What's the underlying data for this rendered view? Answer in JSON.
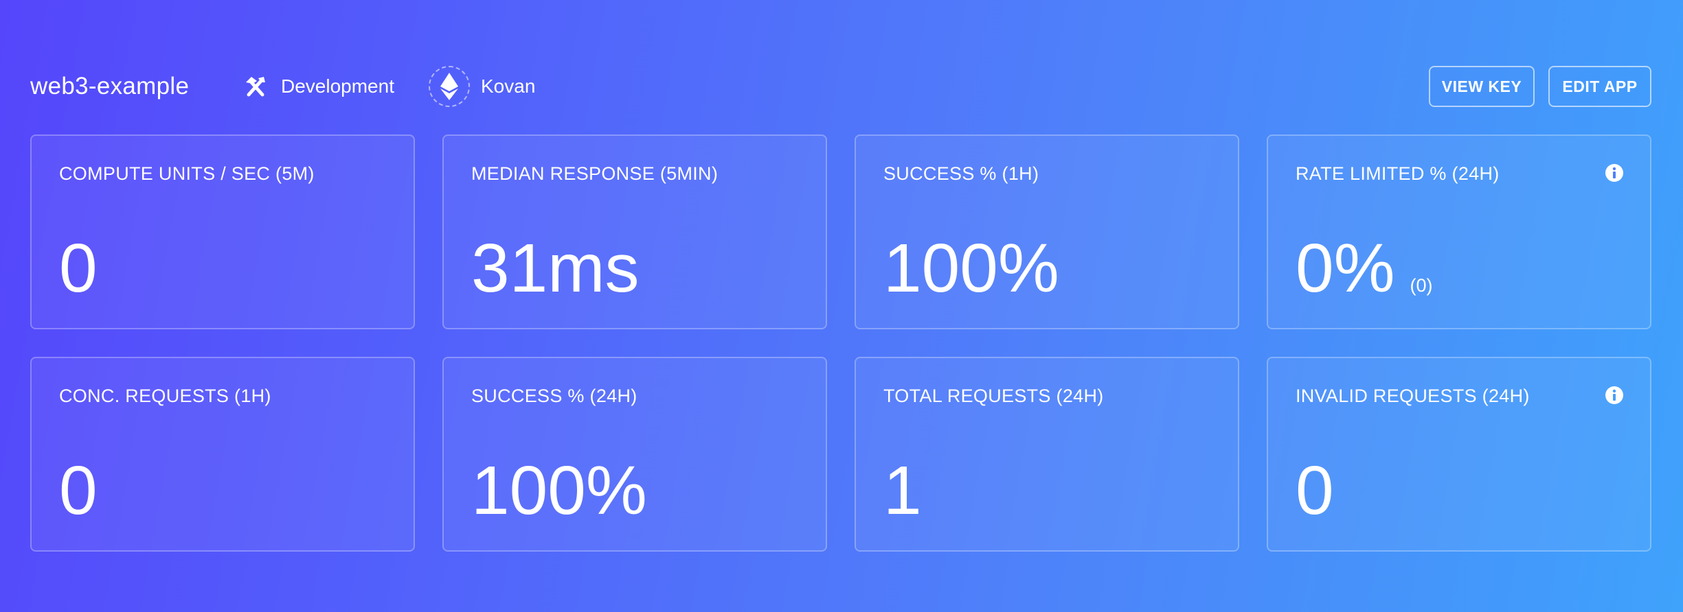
{
  "header": {
    "app_name": "web3-example",
    "environment": {
      "label": "Development",
      "icon": "hammer-pick-icon"
    },
    "network": {
      "label": "Kovan",
      "icon": "ethereum-icon"
    },
    "buttons": {
      "view_key": "VIEW KEY",
      "edit_app": "EDIT APP"
    }
  },
  "metrics": [
    {
      "title": "COMPUTE UNITS / SEC (5M)",
      "value": "0"
    },
    {
      "title": "MEDIAN RESPONSE (5MIN)",
      "value": "31ms"
    },
    {
      "title": "SUCCESS % (1H)",
      "value": "100%"
    },
    {
      "title": "RATE LIMITED % (24H)",
      "value": "0%",
      "sub": "(0)",
      "info_icon": "info-icon"
    },
    {
      "title": "CONC. REQUESTS (1H)",
      "value": "0"
    },
    {
      "title": "SUCCESS % (24H)",
      "value": "100%"
    },
    {
      "title": "TOTAL REQUESTS (24H)",
      "value": "1"
    },
    {
      "title": "INVALID REQUESTS (24H)",
      "value": "0",
      "info_icon": "info-icon"
    }
  ],
  "colors": {
    "gradient_start": "#5546fb",
    "gradient_end": "#3fa2fb",
    "text": "#ffffff"
  }
}
